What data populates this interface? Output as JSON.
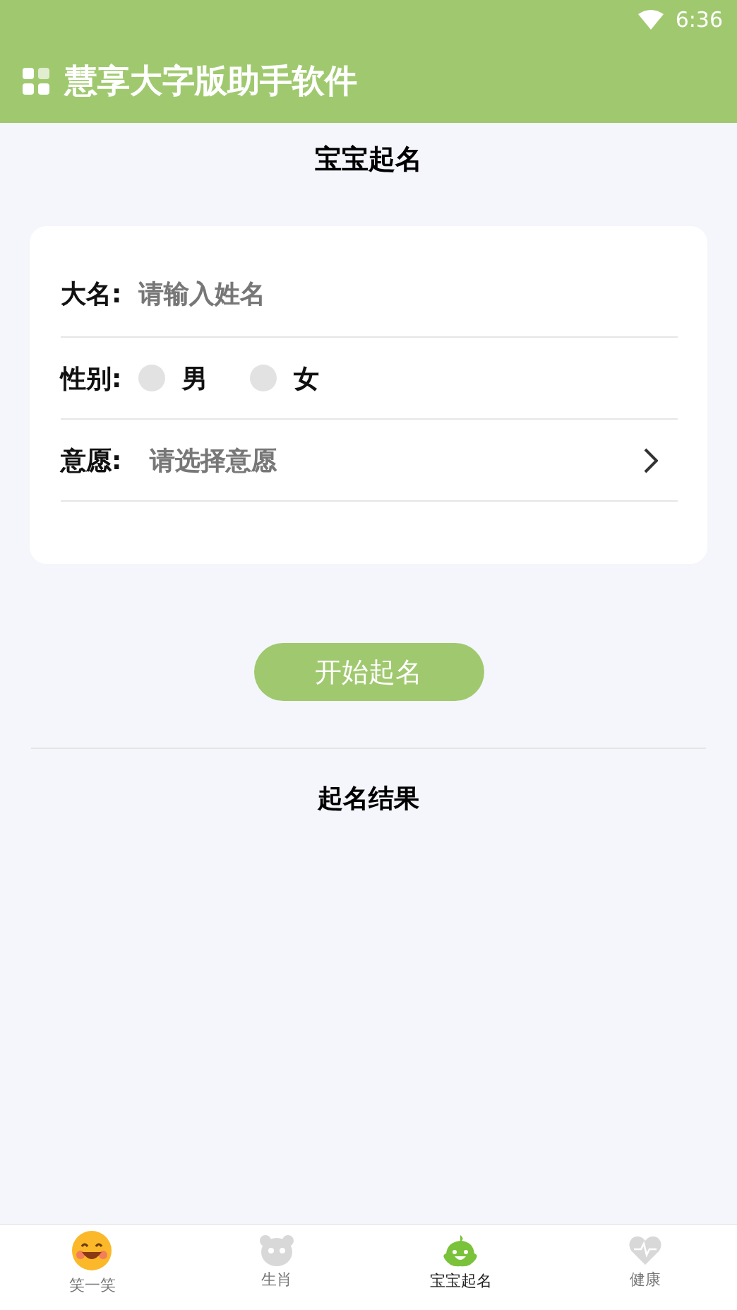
{
  "status_bar": {
    "time": "6:36"
  },
  "app_bar": {
    "title": "慧享大字版助手软件"
  },
  "page_title": "宝宝起名",
  "form": {
    "name_label": "大名:",
    "name_placeholder": "请输入姓名",
    "gender_label": "性别:",
    "genders": [
      {
        "label": "男",
        "selected": false
      },
      {
        "label": "女",
        "selected": false
      }
    ],
    "wish_label": "意愿:",
    "wish_placeholder": "请选择意愿"
  },
  "submit_button": "开始起名",
  "result_title": "起名结果",
  "tabs": [
    {
      "label": "笑一笑",
      "kind": "smile",
      "selected": false
    },
    {
      "label": "生肖",
      "kind": "panda",
      "selected": false
    },
    {
      "label": "宝宝起名",
      "kind": "baby",
      "selected": true
    },
    {
      "label": "健康",
      "kind": "heart",
      "selected": false
    }
  ]
}
